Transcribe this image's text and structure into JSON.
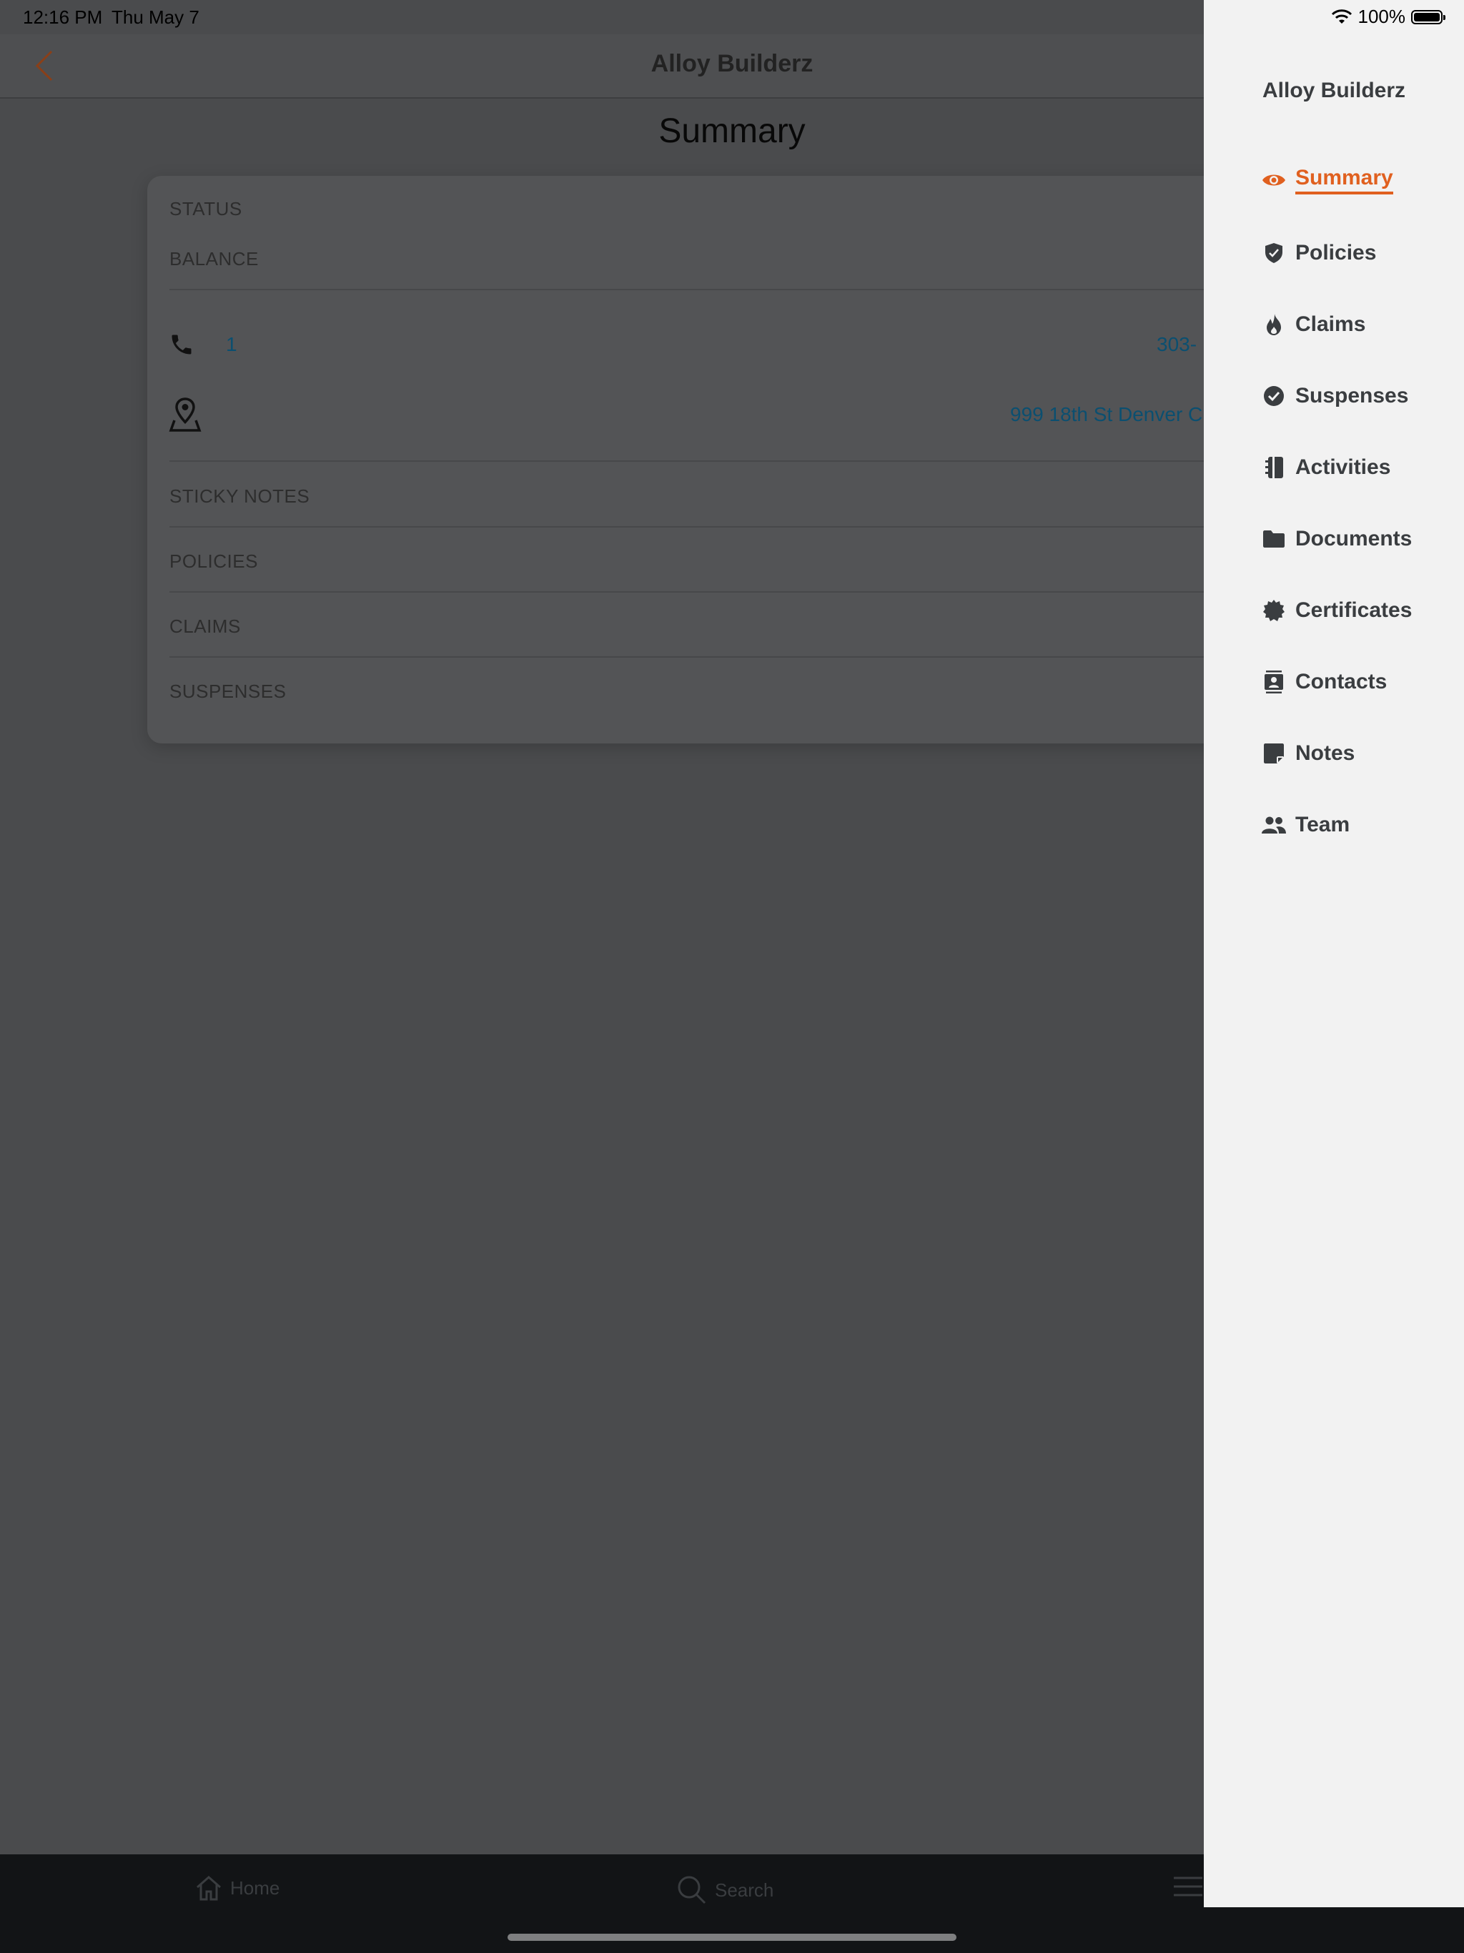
{
  "status_bar": {
    "time": "12:16 PM",
    "date": "Thu May 7",
    "battery": "100%",
    "icons": [
      "wifi-icon",
      "battery-icon"
    ]
  },
  "navbar": {
    "back_icon": "chevron-left-icon",
    "title": "Alloy Builderz"
  },
  "page": {
    "heading": "Summary"
  },
  "card": {
    "status_label": "STATUS",
    "balance_label": "BALANCE",
    "phone": {
      "icon": "phone-icon",
      "index": "1",
      "number": "303-"
    },
    "address": {
      "icon": "map-pin-icon",
      "text": "999 18th St Denver C"
    },
    "sticky_notes_label": "STICKY NOTES",
    "policies_label": "POLICIES",
    "claims_label": "CLAIMS",
    "suspenses_label": "SUSPENSES"
  },
  "drawer": {
    "company": "Alloy Builderz",
    "items": [
      {
        "label": "Summary",
        "icon": "eye-icon",
        "active": true
      },
      {
        "label": "Policies",
        "icon": "shield-icon",
        "active": false
      },
      {
        "label": "Claims",
        "icon": "fire-icon",
        "active": false
      },
      {
        "label": "Suspenses",
        "icon": "check-circle-icon",
        "active": false
      },
      {
        "label": "Activities",
        "icon": "notebook-icon",
        "active": false
      },
      {
        "label": "Documents",
        "icon": "folder-icon",
        "active": false
      },
      {
        "label": "Certificates",
        "icon": "certificate-icon",
        "active": false
      },
      {
        "label": "Contacts",
        "icon": "contact-card-icon",
        "active": false
      },
      {
        "label": "Notes",
        "icon": "sticky-note-icon",
        "active": false
      },
      {
        "label": "Team",
        "icon": "team-icon",
        "active": false
      }
    ]
  },
  "tab_bar": {
    "home": "Home",
    "search": "Search",
    "menu_icon": "hamburger-icon"
  },
  "colors": {
    "accent": "#e0601f",
    "link": "#0b4f70",
    "drawer_bg": "#f2f2f2",
    "overlay_page": "#4a4b4d"
  }
}
